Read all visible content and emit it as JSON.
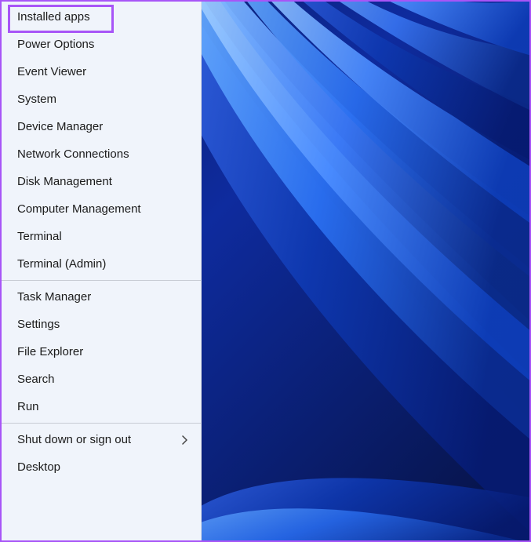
{
  "highlight_color": "#a855f7",
  "menu": {
    "groups": [
      {
        "items": [
          {
            "key": "installed-apps",
            "label": "Installed apps",
            "submenu": false,
            "highlighted": true
          },
          {
            "key": "power-options",
            "label": "Power Options",
            "submenu": false
          },
          {
            "key": "event-viewer",
            "label": "Event Viewer",
            "submenu": false
          },
          {
            "key": "system",
            "label": "System",
            "submenu": false
          },
          {
            "key": "device-manager",
            "label": "Device Manager",
            "submenu": false
          },
          {
            "key": "network-connections",
            "label": "Network Connections",
            "submenu": false
          },
          {
            "key": "disk-management",
            "label": "Disk Management",
            "submenu": false
          },
          {
            "key": "computer-management",
            "label": "Computer Management",
            "submenu": false
          },
          {
            "key": "terminal",
            "label": "Terminal",
            "submenu": false
          },
          {
            "key": "terminal-admin",
            "label": "Terminal (Admin)",
            "submenu": false
          }
        ]
      },
      {
        "items": [
          {
            "key": "task-manager",
            "label": "Task Manager",
            "submenu": false
          },
          {
            "key": "settings",
            "label": "Settings",
            "submenu": false
          },
          {
            "key": "file-explorer",
            "label": "File Explorer",
            "submenu": false
          },
          {
            "key": "search",
            "label": "Search",
            "submenu": false
          },
          {
            "key": "run",
            "label": "Run",
            "submenu": false
          }
        ]
      },
      {
        "items": [
          {
            "key": "shut-down-sign-out",
            "label": "Shut down or sign out",
            "submenu": true
          },
          {
            "key": "desktop",
            "label": "Desktop",
            "submenu": false
          }
        ]
      }
    ]
  }
}
